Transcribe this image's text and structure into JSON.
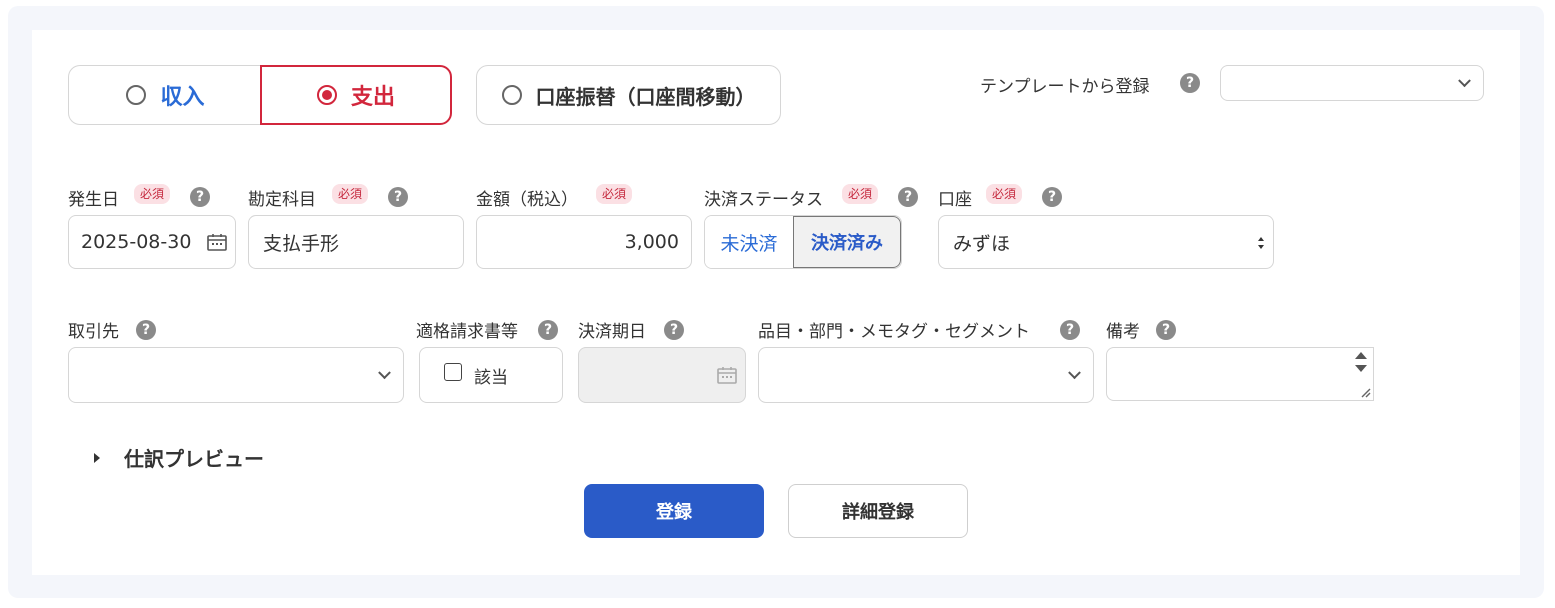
{
  "type_toggle": {
    "income_label": "収入",
    "expense_label": "支出",
    "transfer_label": "口座振替（口座間移動）",
    "selected": "expense"
  },
  "template": {
    "label": "テンプレートから登録",
    "value": ""
  },
  "required_label": "必須",
  "help_glyph": "?",
  "fields": {
    "date": {
      "label": "発生日",
      "value": "2025-08-30"
    },
    "account_item": {
      "label": "勘定科目",
      "value": "支払手形"
    },
    "amount": {
      "label": "金額（税込）",
      "value": "3,000"
    },
    "status": {
      "label": "決済ステータス",
      "option_unpaid": "未決済",
      "option_paid": "決済済み",
      "selected": "paid"
    },
    "wallet": {
      "label": "口座",
      "value": "みずほ"
    },
    "partner": {
      "label": "取引先",
      "value": ""
    },
    "invoice": {
      "label": "適格請求書等",
      "checkbox_label": "該当",
      "checked": false
    },
    "due_date": {
      "label": "決済期日",
      "value": ""
    },
    "tags": {
      "label": "品目・部門・メモタグ・セグメント",
      "value": ""
    },
    "memo": {
      "label": "備考",
      "value": ""
    }
  },
  "preview": {
    "label": "仕訳プレビュー"
  },
  "buttons": {
    "register": "登録",
    "detail_register": "詳細登録"
  },
  "colors": {
    "primary": "#2a5bc8",
    "danger": "#d2263c",
    "income": "#2a6bd6",
    "required_bg": "#fbe0e4"
  }
}
